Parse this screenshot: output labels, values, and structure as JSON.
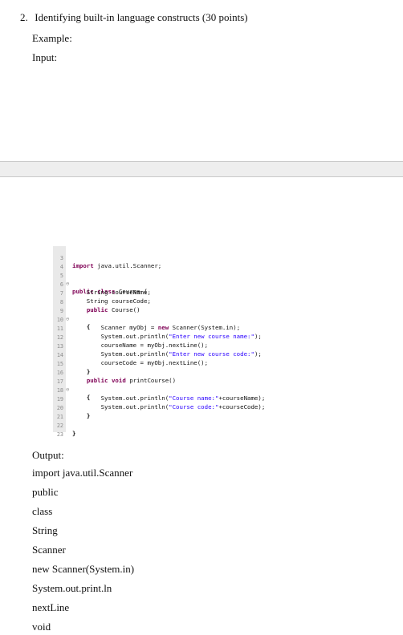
{
  "question": {
    "number": "2.",
    "title": "Identifying built-in language constructs (30 points)",
    "example_label": "Example:",
    "input_label": "Input:",
    "output_label": "Output:"
  },
  "code": {
    "lines": [
      {
        "n": "3",
        "text": "import java.util.Scanner;"
      },
      {
        "n": "4",
        "text": ""
      },
      {
        "n": "5",
        "text": "public class Course {"
      },
      {
        "n": "6",
        "text": "String courseName;"
      },
      {
        "n": "7",
        "text": "String courseCode;"
      },
      {
        "n": "8",
        "text": "public Course()"
      },
      {
        "n": "9",
        "text": "{"
      },
      {
        "n": "10",
        "text": "Scanner myObj = new Scanner(System.in);"
      },
      {
        "n": "11",
        "text": "System.out.println(\"Enter new course name:\");"
      },
      {
        "n": "12",
        "text": "courseName = myObj.nextLine();"
      },
      {
        "n": "13",
        "text": "System.out.println(\"Enter new course code:\");"
      },
      {
        "n": "14",
        "text": "courseCode = myObj.nextLine();"
      },
      {
        "n": "15",
        "text": "}"
      },
      {
        "n": "16",
        "text": "public void printCourse()"
      },
      {
        "n": "17",
        "text": "{"
      },
      {
        "n": "18",
        "text": "System.out.println(\"Course name:\"+courseName);"
      },
      {
        "n": "19",
        "text": "System.out.println(\"Course code:\"+courseCode);"
      },
      {
        "n": "20",
        "text": "}"
      },
      {
        "n": "21",
        "text": ""
      },
      {
        "n": "22",
        "text": "}"
      },
      {
        "n": "23",
        "text": ""
      }
    ],
    "colors": {
      "keyword": "#7f0055",
      "string": "#2a00ff",
      "line_number": "#8c8c8c"
    }
  },
  "output": {
    "items": [
      "import java.util.Scanner",
      "public",
      "class",
      "String",
      "Scanner",
      "new Scanner(System.in)",
      "System.out.print.ln",
      "nextLine",
      "void"
    ]
  }
}
